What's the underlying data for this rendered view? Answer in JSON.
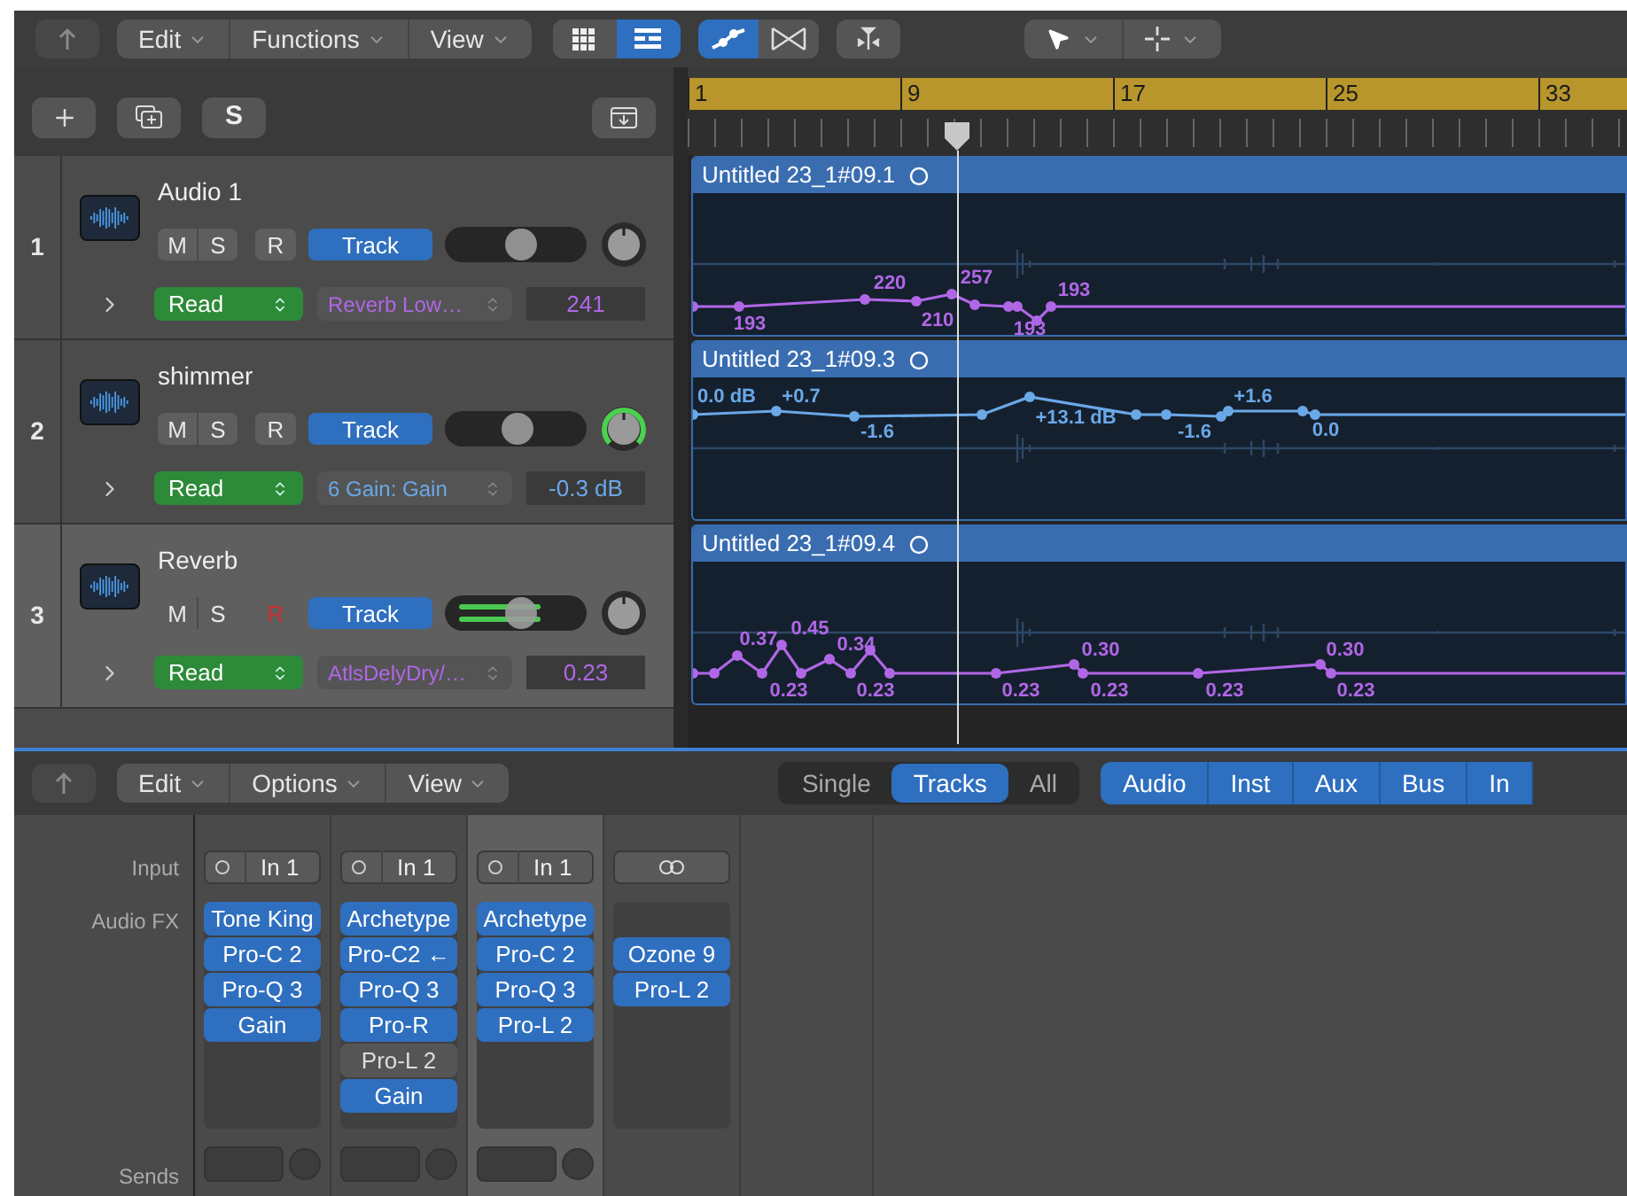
{
  "toolbar": {
    "menus": [
      "Edit",
      "Functions",
      "View"
    ],
    "view_buttons": [
      {
        "kind": "grid",
        "selected": false
      },
      {
        "kind": "list",
        "selected": true
      }
    ],
    "edit_buttons": [
      {
        "kind": "automation",
        "selected": true
      },
      {
        "kind": "crossfade",
        "selected": false
      }
    ],
    "tools": [
      {
        "kind": "pointer"
      },
      {
        "kind": "crosshair"
      }
    ]
  },
  "track_list_header": {
    "solo_label": "S"
  },
  "ruler": {
    "bars": [
      "1",
      "9",
      "17",
      "25",
      "33"
    ]
  },
  "tracks": [
    {
      "number": "1",
      "name": "Audio 1",
      "selected": false,
      "mute": "M",
      "solo": "S",
      "record": "R",
      "record_armed": false,
      "group": "Track",
      "level": 0.55,
      "pan_active": false,
      "mode": "Read",
      "parameter": "Reverb Low…",
      "value": "241",
      "color": "#b067e6",
      "region": {
        "name": "Untitled 23_1#09.1",
        "labels": [
          "220",
          "257",
          "193",
          "193",
          "210",
          "193"
        ]
      }
    },
    {
      "number": "2",
      "name": "shimmer",
      "selected": false,
      "mute": "M",
      "solo": "S",
      "record": "R",
      "record_armed": false,
      "group": "Track",
      "level": 0.52,
      "pan_active": true,
      "mode": "Read",
      "parameter": "6 Gain: Gain",
      "value": "-0.3 dB",
      "color": "#6aa8e8",
      "region": {
        "name": "Untitled 23_1#09.3",
        "labels": [
          "0.0 dB",
          "+0.7",
          "+1.6",
          "+13.1 dB",
          "-1.6",
          "-1.6",
          "0.0"
        ]
      }
    },
    {
      "number": "3",
      "name": "Reverb",
      "selected": true,
      "mute": "M",
      "solo": "S",
      "record": "R",
      "record_armed": true,
      "group": "Track",
      "level": 0.55,
      "metering": true,
      "pan_active": false,
      "mode": "Read",
      "parameter": "AtlsDelyDry/…",
      "value": "0.23",
      "color": "#b067e6",
      "region": {
        "name": "Untitled 23_1#09.4",
        "labels": [
          "0.37",
          "0.45",
          "0.34",
          "0.30",
          "0.30",
          "0.23",
          "0.23",
          "0.23",
          "0.23",
          "0.23",
          "0.23"
        ]
      }
    }
  ],
  "mixer": {
    "menus": [
      "Edit",
      "Options",
      "View"
    ],
    "scope_tabs": [
      {
        "label": "Single",
        "selected": false
      },
      {
        "label": "Tracks",
        "selected": true
      },
      {
        "label": "All",
        "selected": false
      }
    ],
    "filters": [
      {
        "label": "Audio",
        "on": true
      },
      {
        "label": "Inst",
        "on": true
      },
      {
        "label": "Aux",
        "on": true
      },
      {
        "label": "Bus",
        "on": true
      },
      {
        "label": "In",
        "on": true
      }
    ],
    "row_labels": {
      "input": "Input",
      "audio_fx": "Audio FX",
      "sends": "Sends"
    },
    "strips": [
      {
        "selected": false,
        "has_sends": true,
        "input": {
          "kind": "mono",
          "label": "In 1"
        },
        "plugins": [
          {
            "kind": "plugin",
            "name": "Tone King",
            "on": true
          },
          {
            "kind": "plugin",
            "name": "Pro-C 2",
            "on": true
          },
          {
            "kind": "plugin",
            "name": "Pro-Q 3",
            "on": true
          },
          {
            "kind": "plugin",
            "name": "Gain",
            "on": true
          }
        ]
      },
      {
        "selected": false,
        "has_sends": true,
        "input": {
          "kind": "mono",
          "label": "In 1"
        },
        "plugins": [
          {
            "kind": "plugin",
            "name": "Archetype",
            "on": true
          },
          {
            "kind": "plugin",
            "name": "Pro-C2 ←",
            "on": true
          },
          {
            "kind": "plugin",
            "name": "Pro-Q 3",
            "on": true
          },
          {
            "kind": "plugin",
            "name": "Pro-R",
            "on": true
          },
          {
            "kind": "plugin",
            "name": "Pro-L 2",
            "on": false
          },
          {
            "kind": "plugin",
            "name": "Gain",
            "on": true
          }
        ]
      },
      {
        "selected": true,
        "has_sends": true,
        "input": {
          "kind": "mono",
          "label": "In 1"
        },
        "plugins": [
          {
            "kind": "plugin",
            "name": "Archetype",
            "on": true
          },
          {
            "kind": "plugin",
            "name": "Pro-C 2",
            "on": true
          },
          {
            "kind": "plugin",
            "name": "Pro-Q 3",
            "on": true
          },
          {
            "kind": "plugin",
            "name": "Pro-L 2",
            "on": true
          }
        ]
      },
      {
        "selected": false,
        "has_sends": false,
        "input": {
          "kind": "stereo"
        },
        "plugins": [
          {
            "kind": "empty"
          },
          {
            "kind": "plugin",
            "name": "Ozone 9",
            "on": true
          },
          {
            "kind": "plugin",
            "name": "Pro-L 2",
            "on": true
          }
        ]
      }
    ]
  }
}
